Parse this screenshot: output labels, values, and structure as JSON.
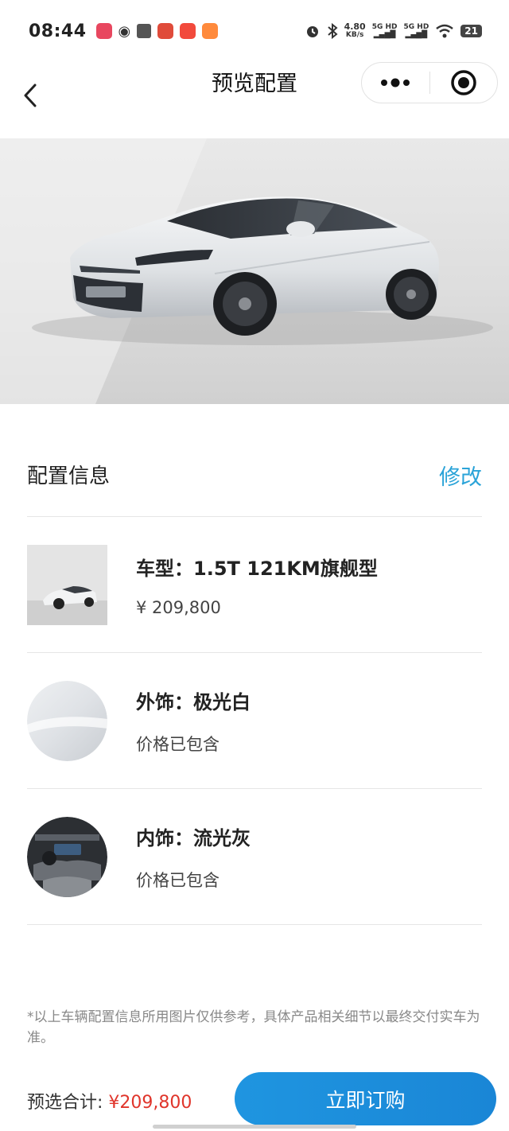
{
  "status_bar": {
    "time": "08:44",
    "net_speed_value": "4.80",
    "net_speed_unit": "KB/s",
    "sim1": "5G HD",
    "sim2": "5G HD",
    "battery": "21",
    "icons": [
      "alarm-icon",
      "bluetooth-icon",
      "signal-icon",
      "wifi-icon",
      "battery-icon"
    ]
  },
  "nav": {
    "title": "预览配置",
    "back_icon": "chevron-left-icon",
    "more_icon": "more-dots-icon",
    "close_icon": "target-close-icon"
  },
  "hero": {
    "alt": "car-hero-image"
  },
  "config": {
    "title": "配置信息",
    "modify_label": "修改",
    "items": [
      {
        "name": "车型：1.5T 121KM旗舰型",
        "price": "¥ 209,800"
      },
      {
        "name": "外饰：极光白",
        "price": "价格已包含"
      },
      {
        "name": "内饰：流光灰",
        "price": "价格已包含"
      }
    ]
  },
  "disclaimer": "*以上车辆配置信息所用图片仅供参考，具体产品相关细节以最终交付实车为准。",
  "footer": {
    "total_label": "预选合计: ",
    "total_value": "¥209,800",
    "buy_label": "立即订购"
  },
  "colors": {
    "accent": "#2aa3d8",
    "price_red": "#e0352b",
    "button": "#1f95e0"
  }
}
